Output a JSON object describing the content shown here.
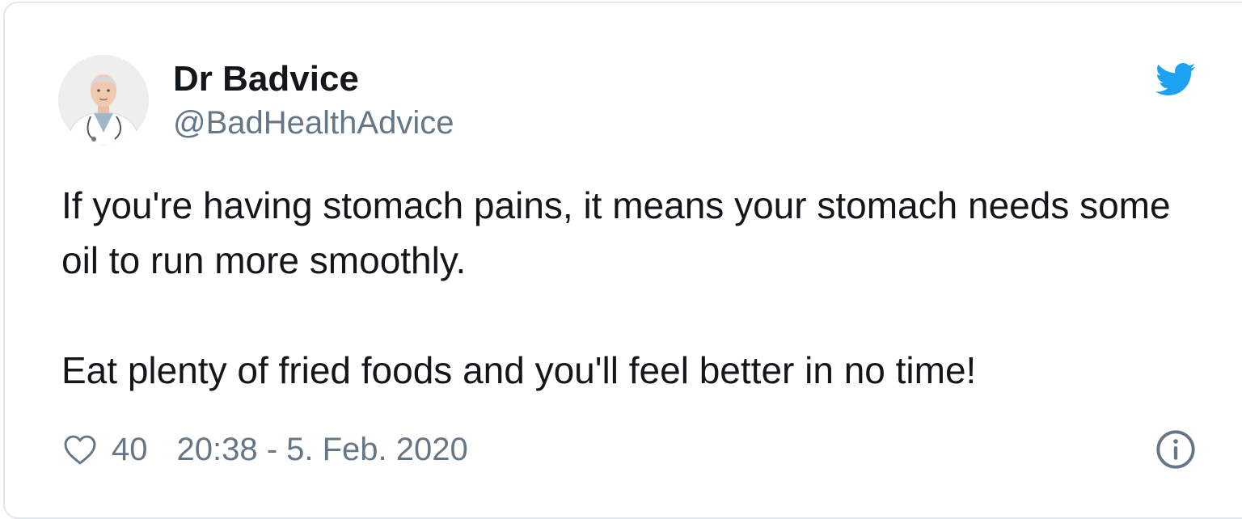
{
  "author": {
    "display_name": "Dr Badvice",
    "handle": "@BadHealthAdvice",
    "avatar_icon": "doctor-avatar"
  },
  "tweet": {
    "paragraphs": [
      "If you're having stomach pains, it means your stomach needs some oil to run more smoothly.",
      "Eat plenty of fried foods and you'll feel better in no time!"
    ]
  },
  "footer": {
    "like_icon": "heart-outline-icon",
    "like_count": "40",
    "timestamp": "20:38 - 5. Feb. 2020",
    "info_icon": "info-circle-icon"
  },
  "colors": {
    "brand_blue": "#1da1f2",
    "text_primary": "#14171a",
    "text_secondary": "#657786",
    "border": "#e1e8ed"
  }
}
